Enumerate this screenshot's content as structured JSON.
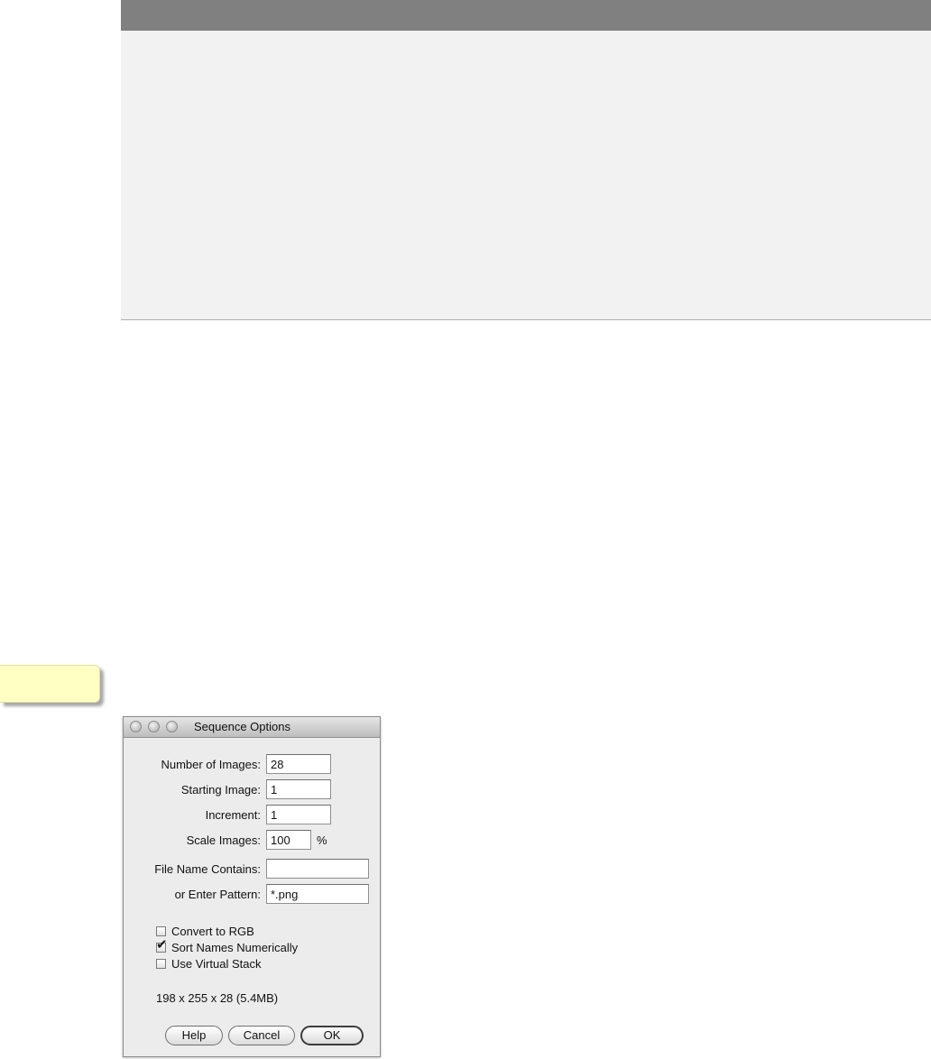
{
  "dialog": {
    "title": "Sequence Options",
    "fields": {
      "number_of_images": {
        "label": "Number of Images:",
        "value": "28"
      },
      "starting_image": {
        "label": "Starting Image:",
        "value": "1"
      },
      "increment": {
        "label": "Increment:",
        "value": "1"
      },
      "scale_images": {
        "label": "Scale Images:",
        "value": "100",
        "unit": "%"
      },
      "file_name_contains": {
        "label": "File Name Contains:",
        "value": ""
      },
      "enter_pattern": {
        "label": "or Enter Pattern:",
        "value": "*.png"
      }
    },
    "checkboxes": {
      "convert_rgb": {
        "label": "Convert to RGB",
        "checked": false
      },
      "sort_numerically": {
        "label": "Sort Names Numerically",
        "checked": true
      },
      "virtual_stack": {
        "label": "Use Virtual Stack",
        "checked": false
      }
    },
    "info": "198 x 255 x 28 (5.4MB)",
    "buttons": {
      "help": "Help",
      "cancel": "Cancel",
      "ok": "OK"
    }
  },
  "colors": {
    "top_panel": "#f2f2f2",
    "top_header": "#808080",
    "note": "#ffffc4",
    "dialog_bg": "#ececec"
  }
}
